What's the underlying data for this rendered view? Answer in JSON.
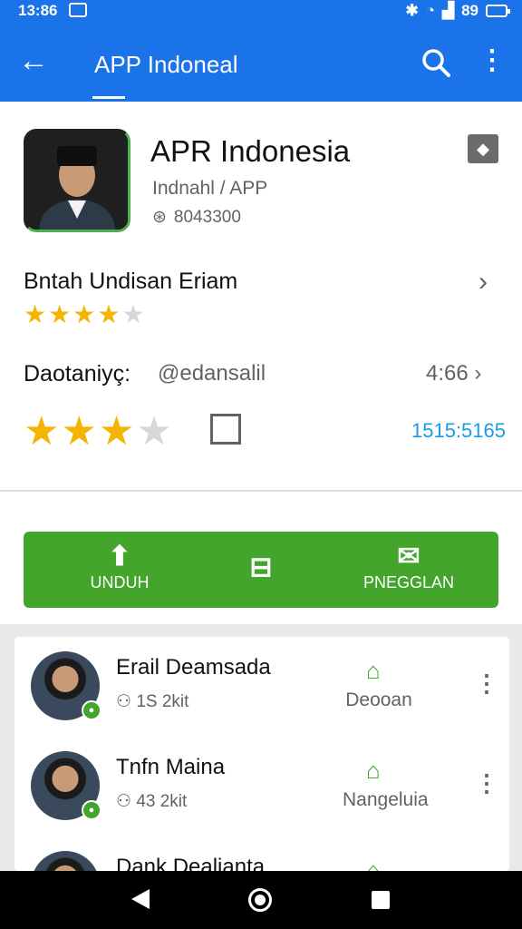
{
  "status_bar": {
    "time": "13:86",
    "battery": "89"
  },
  "app_bar": {
    "title": "APP Indoneal",
    "back_icon": "arrow-left-icon",
    "search_icon": "search-icon",
    "more_icon": "more-vert-icon"
  },
  "app": {
    "name": "APR Indonesia",
    "developer": "Indnahl / APP",
    "meta": "8043300"
  },
  "rating_row": {
    "label": "Bntah Undisan Eriam",
    "stars": 4
  },
  "developer_row": {
    "label": "Daotaniyç:",
    "handle": "@edansalil",
    "count": "4:66"
  },
  "big_rating": {
    "stars": 3,
    "value": "1515:5165"
  },
  "actions": [
    {
      "label": "UNDUH",
      "icon": "upload-icon"
    },
    {
      "label": "",
      "icon": "grid-icon"
    },
    {
      "label": "PNEGGLAN",
      "icon": "message-icon"
    }
  ],
  "list": [
    {
      "name": "Erail Deamsada",
      "meta": "1S 2kit",
      "action": "Deooan"
    },
    {
      "name": "Tnfn Maina",
      "meta": "43 2kit",
      "action": "Nangeluia"
    },
    {
      "name": "Dank Dealianta",
      "meta": "",
      "action": ""
    }
  ],
  "colors": {
    "primary": "#1a73e8",
    "green": "#43a52b",
    "star": "#f5b400",
    "link": "#1a9be8"
  }
}
